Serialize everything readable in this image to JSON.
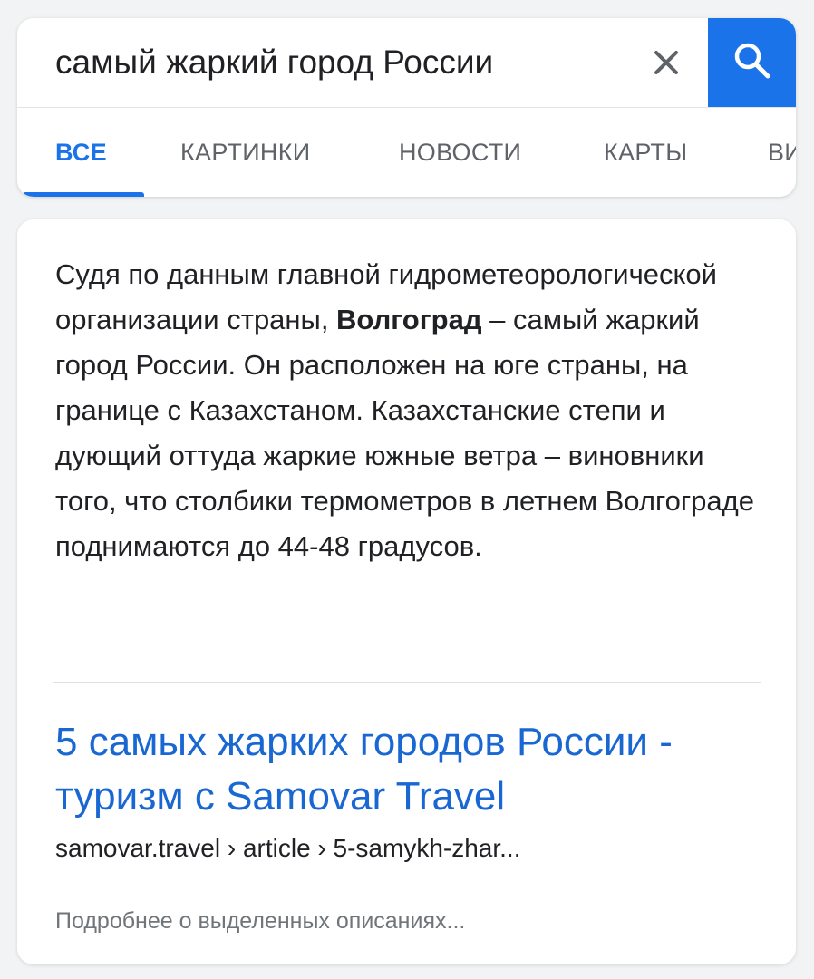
{
  "search": {
    "query": "самый жаркий город России",
    "clear_icon": "close-icon",
    "search_icon": "search-icon",
    "accent": "#1a73e8"
  },
  "tabs": [
    {
      "label": "ВСЕ",
      "active": true
    },
    {
      "label": "КАРТИНКИ",
      "active": false
    },
    {
      "label": "НОВОСТИ",
      "active": false
    },
    {
      "label": "КАРТЫ",
      "active": false
    },
    {
      "label": "ВИ",
      "active": false
    }
  ],
  "featured_snippet": {
    "text_before": "Судя по данным главной гидрометеорологической организации страны, ",
    "highlight": "Волгоград",
    "text_after": " – самый жаркий город России. Он расположен на юге страны, на границе с Казахстаном. Казахстанские степи и дующий оттуда жаркие южные ветра – виновники того, что столбики термометров в летнем Волгограде поднимаются до 44-48 градусов."
  },
  "result": {
    "title": "5 самых жарких городов России - туризм с Samovar Travel",
    "url": "samovar.travel › article › 5-samykh-zhar..."
  },
  "more_link": "Подробнее о выделенных описаниях..."
}
